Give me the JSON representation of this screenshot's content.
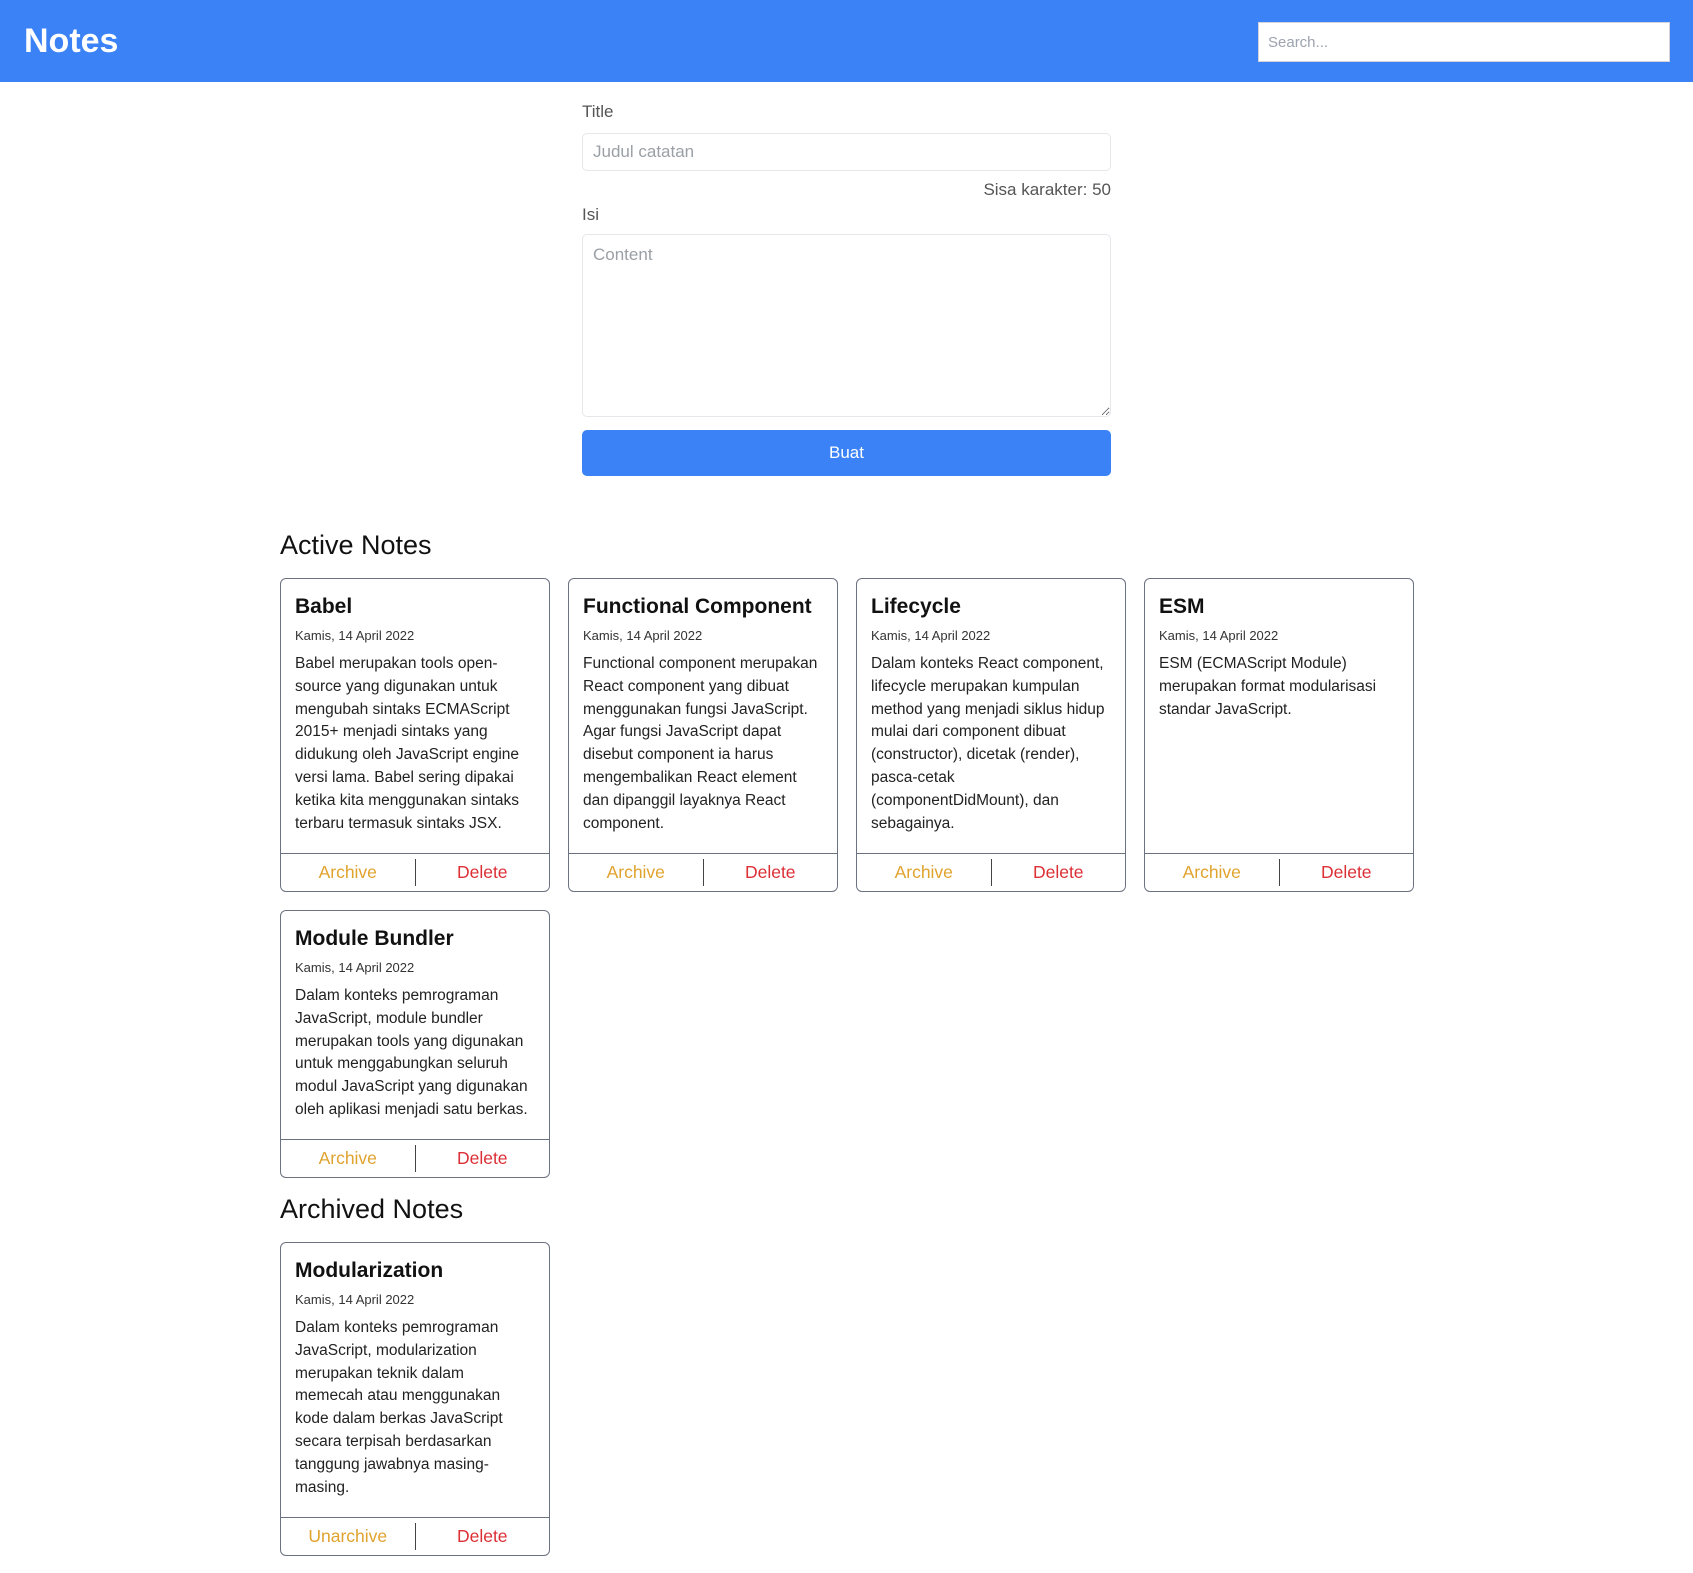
{
  "header": {
    "brand": "Notes",
    "search_placeholder": "Search..."
  },
  "form": {
    "title_label": "Title",
    "title_placeholder": "Judul catatan",
    "char_count": "Sisa karakter: 50",
    "content_label": "Isi",
    "content_placeholder": "Content",
    "submit_label": "Buat"
  },
  "active_heading": "Active Notes",
  "archived_heading": "Archived Notes",
  "notes": [
    {
      "title": "Babel",
      "date": "Kamis, 14 April 2022",
      "body": "Babel merupakan tools open-source yang digunakan untuk mengubah sintaks ECMAScript 2015+ menjadi sintaks yang didukung oleh JavaScript engine versi lama. Babel sering dipakai ketika kita menggunakan sintaks terbaru termasuk sintaks JSX.",
      "primary_action": "Archive",
      "delete_action": "Delete"
    },
    {
      "title": "Functional Component",
      "date": "Kamis, 14 April 2022",
      "body": "Functional component merupakan React component yang dibuat menggunakan fungsi JavaScript. Agar fungsi JavaScript dapat disebut component ia harus mengembalikan React element dan dipanggil layaknya React component.",
      "primary_action": "Archive",
      "delete_action": "Delete"
    },
    {
      "title": "Lifecycle",
      "date": "Kamis, 14 April 2022",
      "body": "Dalam konteks React component, lifecycle merupakan kumpulan method yang menjadi siklus hidup mulai dari component dibuat (constructor), dicetak (render), pasca-cetak (componentDidMount), dan sebagainya.",
      "primary_action": "Archive",
      "delete_action": "Delete"
    },
    {
      "title": "ESM",
      "date": "Kamis, 14 April 2022",
      "body": "ESM (ECMAScript Module) merupakan format modularisasi standar JavaScript.",
      "primary_action": "Archive",
      "delete_action": "Delete"
    },
    {
      "title": "Module Bundler",
      "date": "Kamis, 14 April 2022",
      "body": "Dalam konteks pemrograman JavaScript, module bundler merupakan tools yang digunakan untuk menggabungkan seluruh modul JavaScript yang digunakan oleh aplikasi menjadi satu berkas.",
      "primary_action": "Archive",
      "delete_action": "Delete"
    },
    {
      "title": "Modularization",
      "date": "Kamis, 14 April 2022",
      "body": "Dalam konteks pemrograman JavaScript, modularization merupakan teknik dalam memecah atau menggunakan kode dalam berkas JavaScript secara terpisah berdasarkan tanggung jawabnya masing-masing.",
      "primary_action": "Unarchive",
      "delete_action": "Delete"
    }
  ],
  "colors": {
    "primary": "#3b82f6",
    "archive": "#e0a32e",
    "delete": "#dc2f35"
  }
}
